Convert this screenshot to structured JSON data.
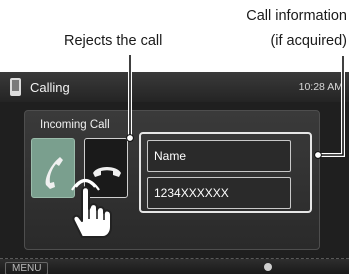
{
  "annotations": {
    "reject_callout": "Rejects the call",
    "info_callout_line1": "Call information",
    "info_callout_line2": "(if acquired)"
  },
  "statusbar": {
    "title": "Calling",
    "clock": "10:28 AM"
  },
  "panel": {
    "title": "Incoming Call"
  },
  "caller": {
    "name": "Name",
    "number": "1234XXXXXX"
  },
  "bottombar": {
    "menu_label": "MENU"
  },
  "icons": {
    "answer": "phone-answer-icon",
    "reject": "phone-reject-icon",
    "pointer": "hand-pointer-icon",
    "status": "phone-status-icon"
  },
  "colors": {
    "answer_button": "#7a9f8e",
    "reject_button": "#1a1a1a",
    "screen_background": "#1f1f1f"
  }
}
